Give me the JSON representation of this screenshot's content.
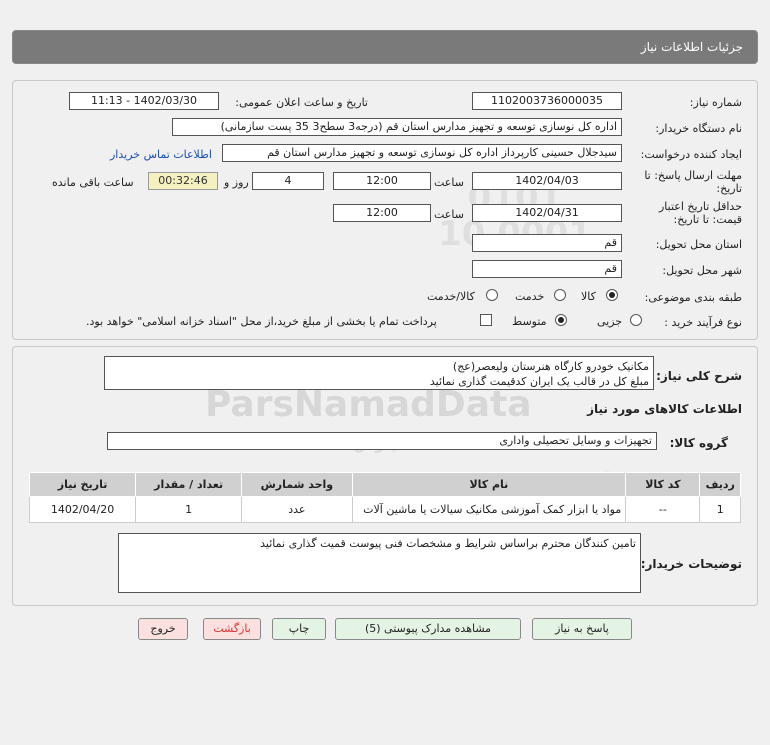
{
  "header": {
    "title": "جزئیات اطلاعات نیاز"
  },
  "form": {
    "need_number_label": "شماره نیاز:",
    "need_number": "1102003736000035",
    "announce_label": "تاریخ و ساعت اعلان عمومی:",
    "announce_value": "1402/03/30 - 11:13",
    "buyer_org_label": "نام دستگاه خریدار:",
    "buyer_org": "اداره کل نوسازی   توسعه و تجهیز مدارس استان قم (درجه3 سطح3  35 پست سازمانی)",
    "requester_label": "ایجاد کننده درخواست:",
    "requester": "سیدجلال حسینی کارپرداز اداره کل نوسازی   توسعه و تجهیز مدارس استان قم",
    "contact_link": "اطلاعات تماس خریدار",
    "reply_deadline_label_1": "مهلت ارسال پاسخ: تا",
    "reply_deadline_label_2": "تاریخ:",
    "reply_date": "1402/04/03",
    "time_label": "ساعت",
    "reply_time": "12:00",
    "days_value": "4",
    "days_label": "روز و",
    "remaining_time": "00:32:46",
    "remaining_label": "ساعت باقی مانده",
    "validity_label_1": "حداقل تاریخ اعتبار",
    "validity_label_2": "قیمت: تا تاریخ:",
    "validity_date": "1402/04/31",
    "validity_time": "12:00",
    "province_label": "استان محل تحویل:",
    "province": "قم",
    "city_label": "شهر محل تحویل:",
    "city": "قم",
    "category_label": "طبقه بندی موضوعی:",
    "category_options": [
      "کالا",
      "خدمت",
      "کالا/خدمت"
    ],
    "process_label": "نوع فرآیند خرید :",
    "process_options": [
      "جزیی",
      "متوسط"
    ],
    "payment_note": "پرداخت تمام یا بخشی از مبلغ خرید،از محل \"اسناد خزانه اسلامی\" خواهد بود."
  },
  "details": {
    "summary_label": "شرح کلی نیاز:",
    "summary_line_1": "مکانیک خودرو کارگاه هنرستان ولیعصر(عج)",
    "summary_line_2": "مبلغ کل در قالب یک ایران کدقیمت گذاری نمائید",
    "goods_info_title": "اطلاعات کالاهای مورد نیاز",
    "goods_group_label": "گروه کالا:",
    "goods_group": "تجهیزات و وسایل تحصیلی واداری",
    "table_headers": [
      "ردیف",
      "کد کالا",
      "نام کالا",
      "واحد شمارش",
      "تعداد / مقدار",
      "تاریخ نیاز"
    ],
    "table_rows": [
      [
        "1",
        "--",
        "مواد یا ابزار کمک آموزشی مکانیک سیالات یا ماشین آلات",
        "عدد",
        "1",
        "1402/04/20"
      ]
    ],
    "buyer_notes_label": "توضیحات خریدار:",
    "buyer_notes": "تامین کنندگان محترم براساس شرایط و مشخصات فنی پیوست قمیت گذاری نمائید"
  },
  "buttons": {
    "reply": "پاسخ به نیاز",
    "attachments": "مشاهده مدارک پیوستی (5)",
    "print": "چاپ",
    "back": "بازگشت",
    "exit": "خروج"
  },
  "watermark": {
    "brand": "ParsNamadData",
    "line_1": "پایگاه اطلاع رسانی مناقصات و",
    "line_2": "پارس نماد داده",
    "phone": "۰۲۱-۸۸۳۴۹۶۷۰-۵",
    "digits": "0101 0001 10"
  },
  "colors": {
    "header_bg": "#7a7a7a",
    "link": "#1a4fb8",
    "btn_green": "#e4f4e4",
    "btn_pink": "#fbe0e0",
    "remaining_bg": "#f4f0c0"
  }
}
